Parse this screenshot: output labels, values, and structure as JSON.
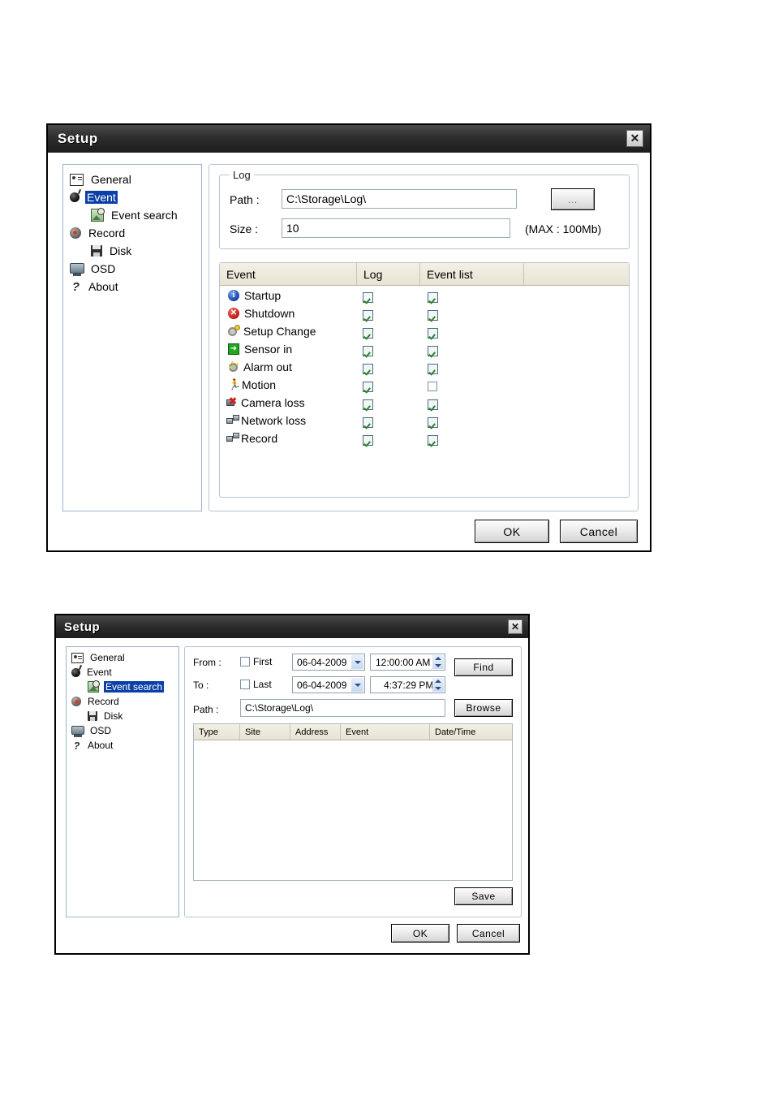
{
  "dialog1": {
    "title": "Setup",
    "close_label": "✕",
    "sidebar": [
      {
        "label": "General",
        "icon": "general-icon",
        "indent": 0,
        "selected": false
      },
      {
        "label": "Event",
        "icon": "bomb-icon",
        "indent": 0,
        "selected": true
      },
      {
        "label": "Event search",
        "icon": "event-search-icon",
        "indent": 1,
        "selected": false
      },
      {
        "label": "Record",
        "icon": "record-icon",
        "indent": 0,
        "selected": false
      },
      {
        "label": "Disk",
        "icon": "floppy-disk-icon",
        "indent": 1,
        "selected": false
      },
      {
        "label": "OSD",
        "icon": "monitor-icon",
        "indent": 0,
        "selected": false
      },
      {
        "label": "About",
        "icon": "question-mark-icon",
        "indent": 0,
        "selected": false
      }
    ],
    "log_group": {
      "title": "Log",
      "path_label": "Path :",
      "path_value": "C:\\Storage\\Log\\",
      "browse_label": "...",
      "size_label": "Size :",
      "size_value": "10",
      "size_hint": "(MAX : 100Mb)"
    },
    "event_table": {
      "columns": [
        "Event",
        "Log",
        "Event list"
      ],
      "rows": [
        {
          "event": "Startup",
          "icon": "info-icon",
          "log": true,
          "event_list": true
        },
        {
          "event": "Shutdown",
          "icon": "error-icon",
          "log": true,
          "event_list": true
        },
        {
          "event": "Setup Change",
          "icon": "gear-icon",
          "log": true,
          "event_list": true
        },
        {
          "event": "Sensor in",
          "icon": "arrow-in-icon",
          "log": true,
          "event_list": true
        },
        {
          "event": "Alarm out",
          "icon": "alarm-icon",
          "log": true,
          "event_list": true
        },
        {
          "event": "Motion",
          "icon": "running-man-icon",
          "log": true,
          "event_list": false
        },
        {
          "event": "Camera loss",
          "icon": "camera-loss-icon",
          "log": true,
          "event_list": true
        },
        {
          "event": "Network loss",
          "icon": "network-loss-icon",
          "log": true,
          "event_list": true
        },
        {
          "event": "Record",
          "icon": "network-icon",
          "log": true,
          "event_list": true
        }
      ]
    },
    "buttons": {
      "ok": "OK",
      "cancel": "Cancel"
    }
  },
  "dialog2": {
    "title": "Setup",
    "close_label": "✕",
    "sidebar": [
      {
        "label": "General",
        "icon": "general-icon",
        "indent": 0,
        "selected": false
      },
      {
        "label": "Event",
        "icon": "bomb-icon",
        "indent": 0,
        "selected": false
      },
      {
        "label": "Event search",
        "icon": "event-search-icon",
        "indent": 1,
        "selected": true
      },
      {
        "label": "Record",
        "icon": "record-icon",
        "indent": 0,
        "selected": false
      },
      {
        "label": "Disk",
        "icon": "floppy-disk-icon",
        "indent": 1,
        "selected": false
      },
      {
        "label": "OSD",
        "icon": "monitor-icon",
        "indent": 0,
        "selected": false
      },
      {
        "label": "About",
        "icon": "question-mark-icon",
        "indent": 0,
        "selected": false
      }
    ],
    "search": {
      "from_label": "From :",
      "from_checkbox_label": "First",
      "from_checked": false,
      "from_date": "06-04-2009",
      "from_time": "12:00:00 AM",
      "to_label": "To :",
      "to_checkbox_label": "Last",
      "to_checked": false,
      "to_date": "06-04-2009",
      "to_time": "4:37:29 PM",
      "find_label": "Find",
      "path_label": "Path :",
      "path_value": "C:\\Storage\\Log\\",
      "browse_label": "Browse"
    },
    "result_table": {
      "columns": [
        "Type",
        "Site",
        "Address",
        "Event",
        "Date/Time"
      ],
      "rows": []
    },
    "save_label": "Save",
    "buttons": {
      "ok": "OK",
      "cancel": "Cancel"
    }
  }
}
